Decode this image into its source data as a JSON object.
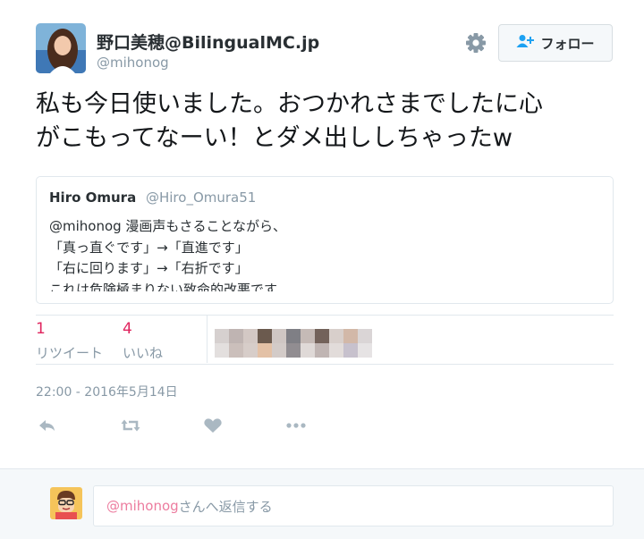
{
  "author": {
    "display_name": "野口美穂@BilingualMC.jp",
    "screen_name": "@mihonog"
  },
  "follow_button_label": "フォロー",
  "tweet_text_lines": [
    "私も今日使いました。おつかれさまでしたに心",
    "がこもってなーい！とダメ出ししちゃったw"
  ],
  "quoted_tweet": {
    "name": "Hiro Omura",
    "handle": "@Hiro_Omura51",
    "lines": [
      "@mihonog 漫画声もさることながら、",
      "「真っ直ぐです」→「直進です」",
      "「右に回ります」→「右折です」",
      "これは危険極まりない致命的改悪です"
    ]
  },
  "stats": {
    "retweets": {
      "count": "1",
      "label": "リツイート"
    },
    "likes": {
      "count": "4",
      "label": "いいね"
    }
  },
  "timestamp": "22:00 - 2016年5月14日",
  "actions": [
    "reply-icon",
    "retweet-icon",
    "heart-icon",
    "more-icon"
  ],
  "reply": {
    "mention": "@mihonog",
    "placeholder_rest": "さんへ返信する"
  },
  "colors": {
    "accent_pink": "#e0245e",
    "muted": "#8899a6",
    "text": "#292f33",
    "border": "#e1e8ed",
    "reply_bg": "#f5f8fa"
  }
}
